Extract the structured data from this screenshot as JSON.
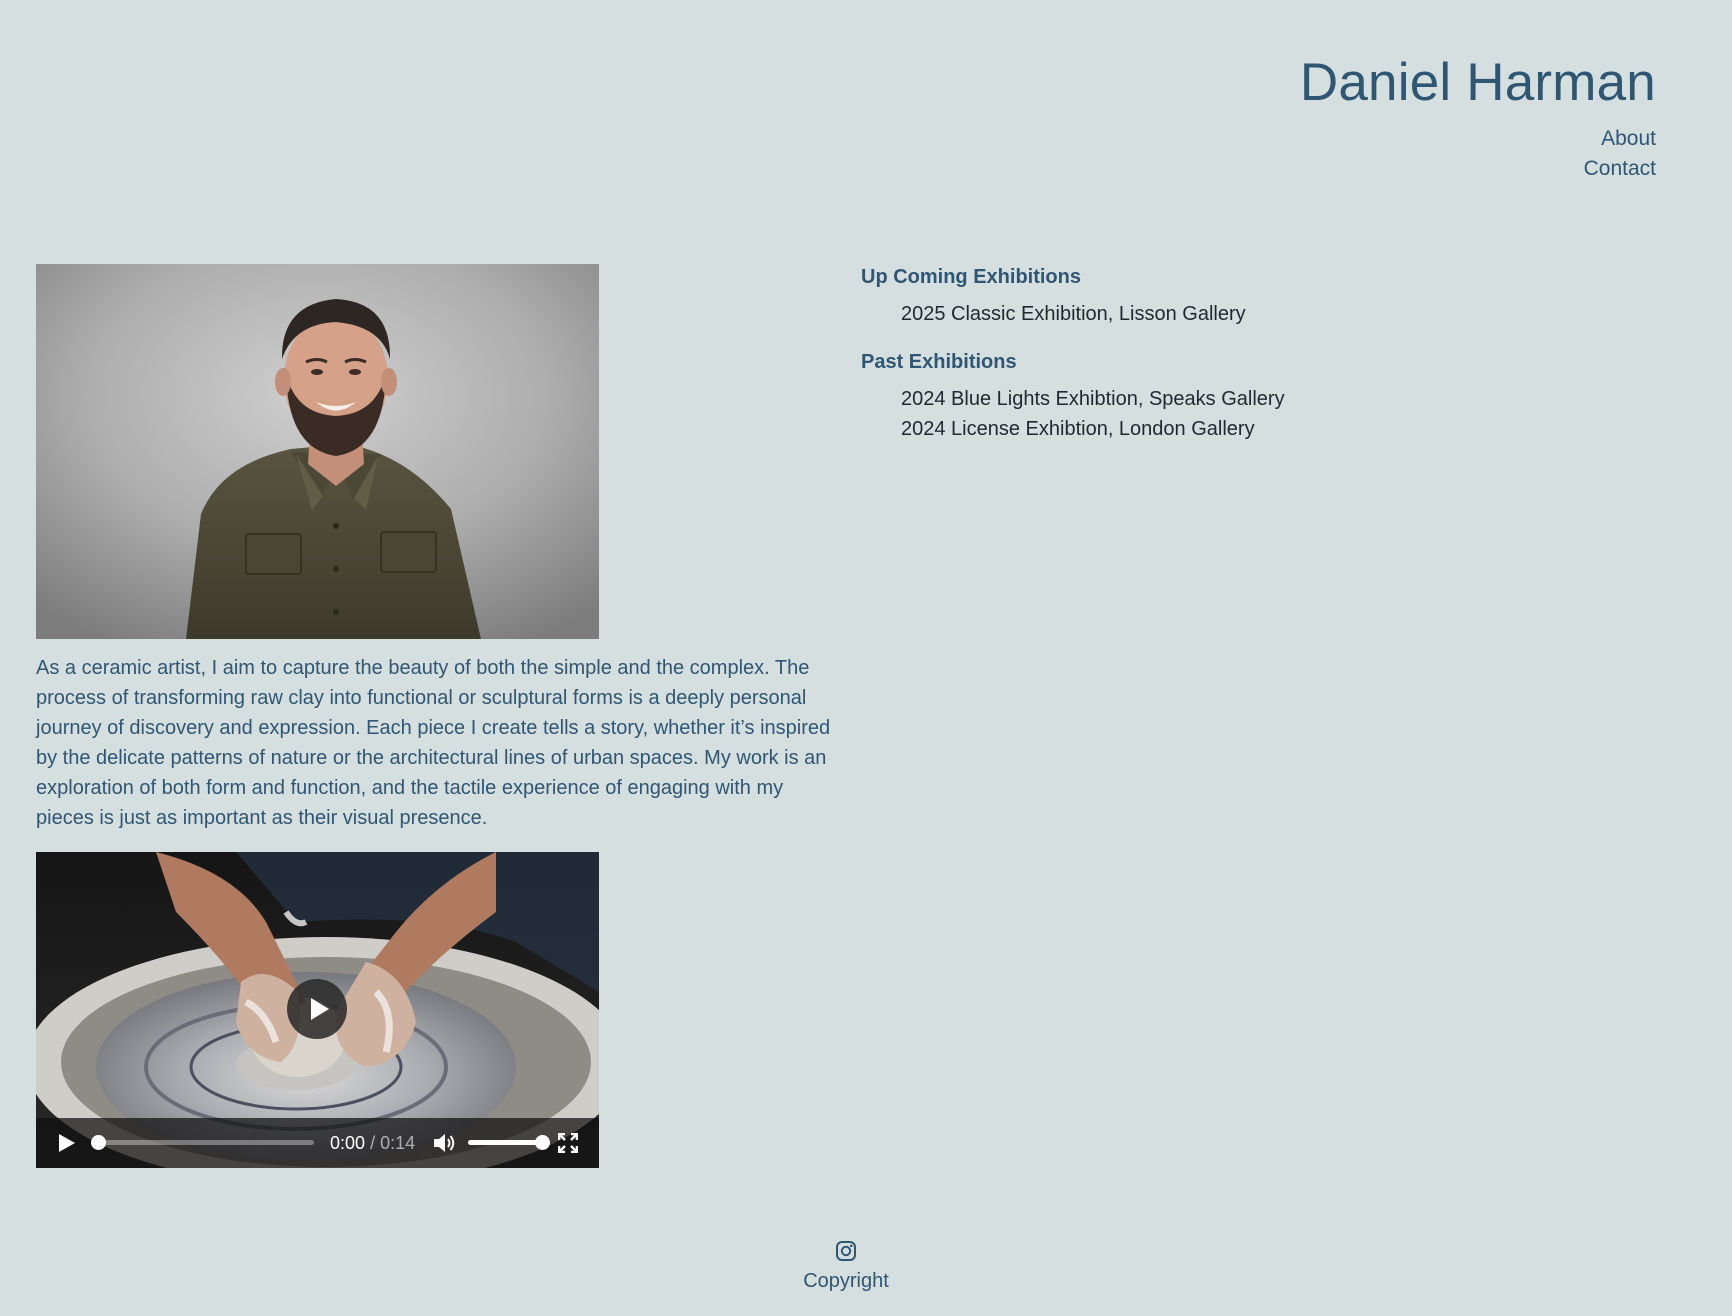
{
  "header": {
    "title": "Daniel Harman",
    "nav": [
      {
        "label": "About"
      },
      {
        "label": "Contact"
      }
    ]
  },
  "portrait": {
    "description": "portrait photo"
  },
  "bio": {
    "text": "As a ceramic artist, I aim to capture the beauty of both the simple and the complex. The process of transforming raw clay into functional or sculptural forms is a deeply personal journey of discovery and expression. Each piece I create tells a story, whether it’s inspired by the delicate patterns of nature or the architectural lines of urban spaces. My work is an exploration of both form and function, and the tactile experience of engaging with my pieces is just as important as their visual presence."
  },
  "video": {
    "current_time": "0:00",
    "separator": "/",
    "duration": "0:14",
    "progress_fraction": 0.0,
    "volume_fraction": 1.0
  },
  "exhibitions": {
    "upcoming_heading": "Up Coming Exhibitions",
    "upcoming": [
      "2025 Classic Exhibition, Lisson Gallery"
    ],
    "past_heading": "Past Exhibitions",
    "past": [
      "2024 Blue Lights Exhibtion, Speaks Gallery",
      "2024 License Exhibtion, London Gallery"
    ]
  },
  "footer": {
    "icon": "instagram-icon",
    "copyright": "Copyright"
  },
  "colors": {
    "background": "#d6dfdf",
    "accent": "#2f5673",
    "body_text": "#1e2a30"
  }
}
